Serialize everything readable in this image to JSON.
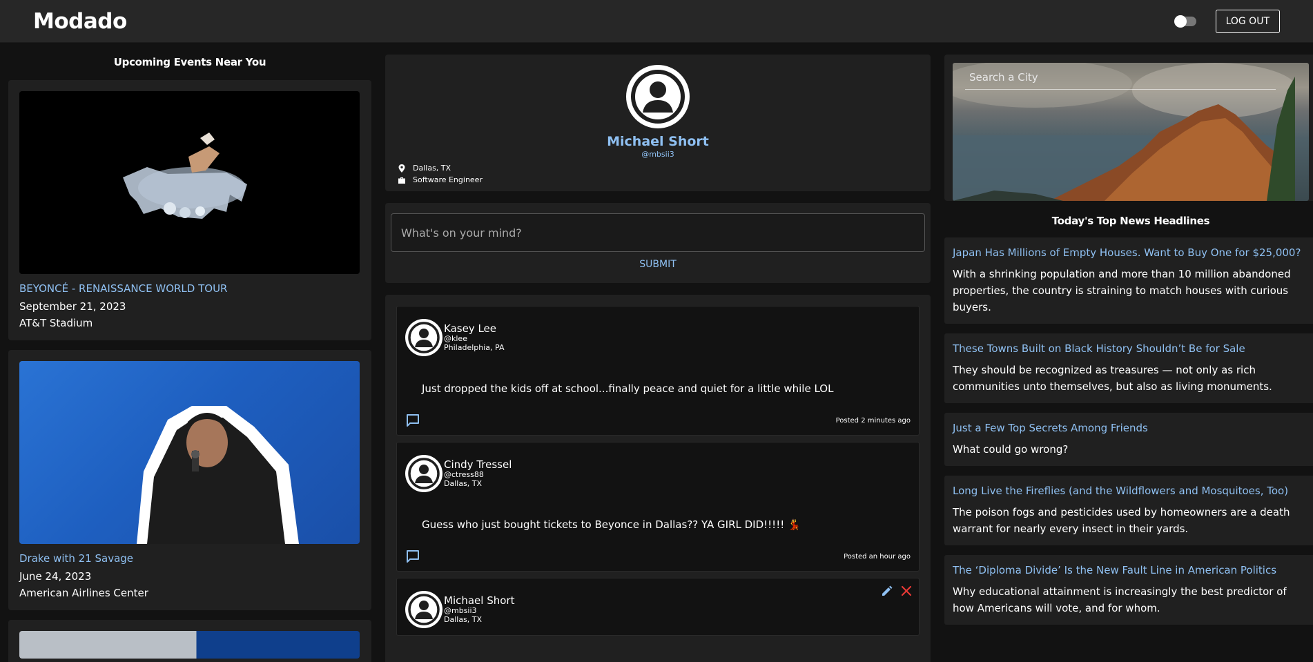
{
  "app": {
    "title": "Modado",
    "logout_label": "LOG OUT"
  },
  "events": {
    "section_title": "Upcoming Events Near You",
    "items": [
      {
        "title": "BEYONCÉ - RENAISSANCE WORLD TOUR",
        "date": "September 21, 2023",
        "venue": "AT&T Stadium"
      },
      {
        "title": "Drake with 21 Savage",
        "date": "June 24, 2023",
        "venue": "American Airlines Center"
      }
    ]
  },
  "profile": {
    "name": "Michael Short",
    "handle": "@mbsii3",
    "location": "Dallas, TX",
    "occupation": "Software Engineer"
  },
  "composer": {
    "placeholder": "What's on your mind?",
    "submit_label": "SUBMIT"
  },
  "posts": [
    {
      "name": "Kasey Lee",
      "handle": "@klee",
      "location": "Philadelphia, PA",
      "body": "Just dropped the kids off at school...finally peace and quiet for a little while LOL",
      "time": "Posted 2 minutes ago"
    },
    {
      "name": "Cindy Tressel",
      "handle": "@ctress88",
      "location": "Dallas, TX",
      "body": "Guess who just bought tickets to Beyonce in Dallas?? YA GIRL DID!!!!! 💃",
      "time": "Posted an hour ago"
    },
    {
      "name": "Michael Short",
      "handle": "@mbsii3",
      "location": "Dallas, TX",
      "body": "",
      "time": ""
    }
  ],
  "city_search": {
    "placeholder": "Search a City"
  },
  "news": {
    "section_title": "Today's Top News Headlines",
    "items": [
      {
        "headline": "Japan Has Millions of Empty Houses. Want to Buy One for $25,000?",
        "summary": "With a shrinking population and more than 10 million abandoned properties, the country is straining to match houses with curious buyers."
      },
      {
        "headline": "These Towns Built on Black History Shouldn’t Be for Sale",
        "summary": "They should be recognized as treasures — not only as rich communities unto themselves, but also as living monuments."
      },
      {
        "headline": "Just a Few Top Secrets Among Friends",
        "summary": "What could go wrong?"
      },
      {
        "headline": "Long Live the Fireflies (and the Wildflowers and Mosquitoes, Too)",
        "summary": "The poison fogs and pesticides used by homeowners are a death warrant for nearly every insect in their yards."
      },
      {
        "headline": "The ‘Diploma Divide’ Is the New Fault Line in American Politics",
        "summary": "Why educational attainment is increasingly the best predictor of how Americans will vote, and for whom."
      }
    ]
  },
  "colors": {
    "accent": "#8fc0f2",
    "panel": "#202020",
    "background": "#121212",
    "topbar": "#272727",
    "delete": "#e53935"
  }
}
